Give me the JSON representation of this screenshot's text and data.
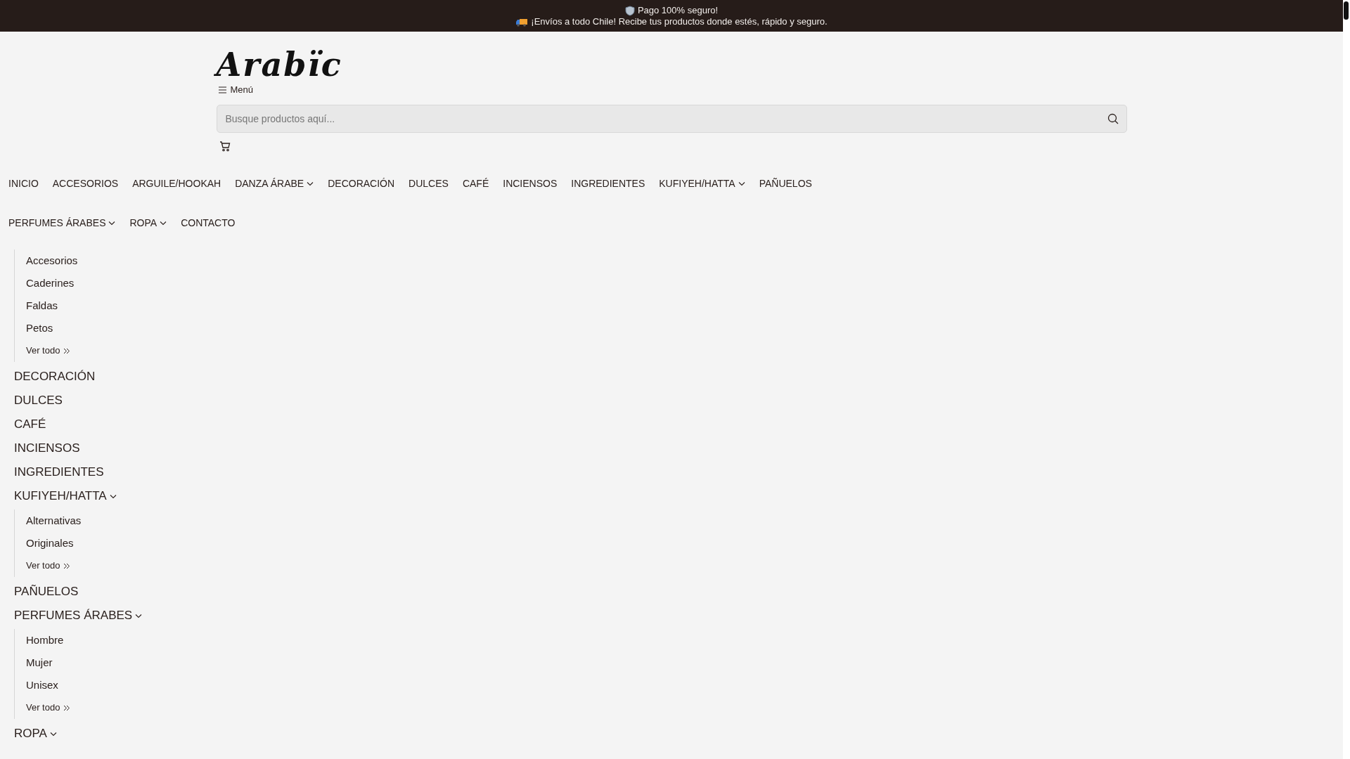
{
  "announcements": [
    {
      "text": "Pago 100% seguro!"
    },
    {
      "text": "¡Envíos a todo Chile! Recibe tus productos donde estés, rápido y seguro."
    }
  ],
  "logo": "Arabïc",
  "menu_button": "Menú",
  "search": {
    "placeholder": "Busque productos aquí..."
  },
  "nav": [
    {
      "label": "INICIO",
      "dropdown": false
    },
    {
      "label": "ACCESORIOS",
      "dropdown": false
    },
    {
      "label": "ARGUILE/HOOKAH",
      "dropdown": false
    },
    {
      "label": "DANZA ÁRABE",
      "dropdown": true
    },
    {
      "label": "DECORACIÓN",
      "dropdown": false
    },
    {
      "label": "DULCES",
      "dropdown": false
    },
    {
      "label": "CAFÉ",
      "dropdown": false
    },
    {
      "label": "INCIENSOS",
      "dropdown": false
    },
    {
      "label": "INGREDIENTES",
      "dropdown": false
    },
    {
      "label": "KUFIYEH/HATTA",
      "dropdown": true
    },
    {
      "label": "PAÑUELOS",
      "dropdown": false
    },
    {
      "label": "PERFUMES ÁRABES",
      "dropdown": true
    },
    {
      "label": "ROPA",
      "dropdown": true
    },
    {
      "label": "CONTACTO",
      "dropdown": false
    }
  ],
  "menu_list": [
    {
      "children": [
        "Accesorios",
        "Caderines",
        "Faldas",
        "Petos"
      ],
      "see_all": "Ver todo"
    },
    {
      "label": "DECORACIÓN",
      "dropdown": false
    },
    {
      "label": "DULCES",
      "dropdown": false
    },
    {
      "label": "CAFÉ",
      "dropdown": false
    },
    {
      "label": "INCIENSOS",
      "dropdown": false
    },
    {
      "label": "INGREDIENTES",
      "dropdown": false
    },
    {
      "label": "KUFIYEH/HATTA",
      "dropdown": true,
      "children": [
        "Alternativas",
        "Originales"
      ],
      "see_all": "Ver todo"
    },
    {
      "label": "PAÑUELOS",
      "dropdown": false
    },
    {
      "label": "PERFUMES ÁRABES",
      "dropdown": true,
      "children": [
        "Hombre",
        "Mujer",
        "Unisex"
      ],
      "see_all": "Ver todo"
    },
    {
      "label": "ROPA",
      "dropdown": true
    }
  ]
}
